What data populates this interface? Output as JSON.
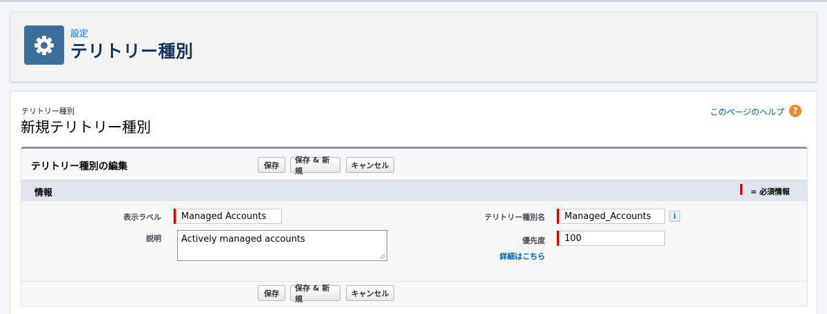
{
  "header": {
    "breadcrumb": "設定",
    "title": "テリトリー種別",
    "icon": "gear-icon",
    "tile_color": "#3c6e99"
  },
  "page": {
    "breadcrumb": "テリトリー種別",
    "title": "新規テリトリー種別",
    "help_link": "このページのヘルプ",
    "help_icon_glyph": "?"
  },
  "edit": {
    "title": "テリトリー種別の編集",
    "buttons": {
      "save": "保存",
      "save_new": "保存 & 新規",
      "cancel": "キャンセル"
    }
  },
  "section": {
    "title": "情報",
    "required_legend": "= 必須情報"
  },
  "fields": {
    "label": {
      "label": "表示ラベル",
      "value": "Managed Accounts"
    },
    "description": {
      "label": "説明",
      "value": "Actively managed accounts"
    },
    "api_name": {
      "label": "テリトリー種別名",
      "value": "Managed_Accounts",
      "info_glyph": "i"
    },
    "priority": {
      "label": "優先度",
      "value": "100",
      "link": "詳細はこちら"
    }
  },
  "colors": {
    "required": "#cc0000",
    "link": "#015ba7",
    "help_icon": "#e88f2d"
  }
}
